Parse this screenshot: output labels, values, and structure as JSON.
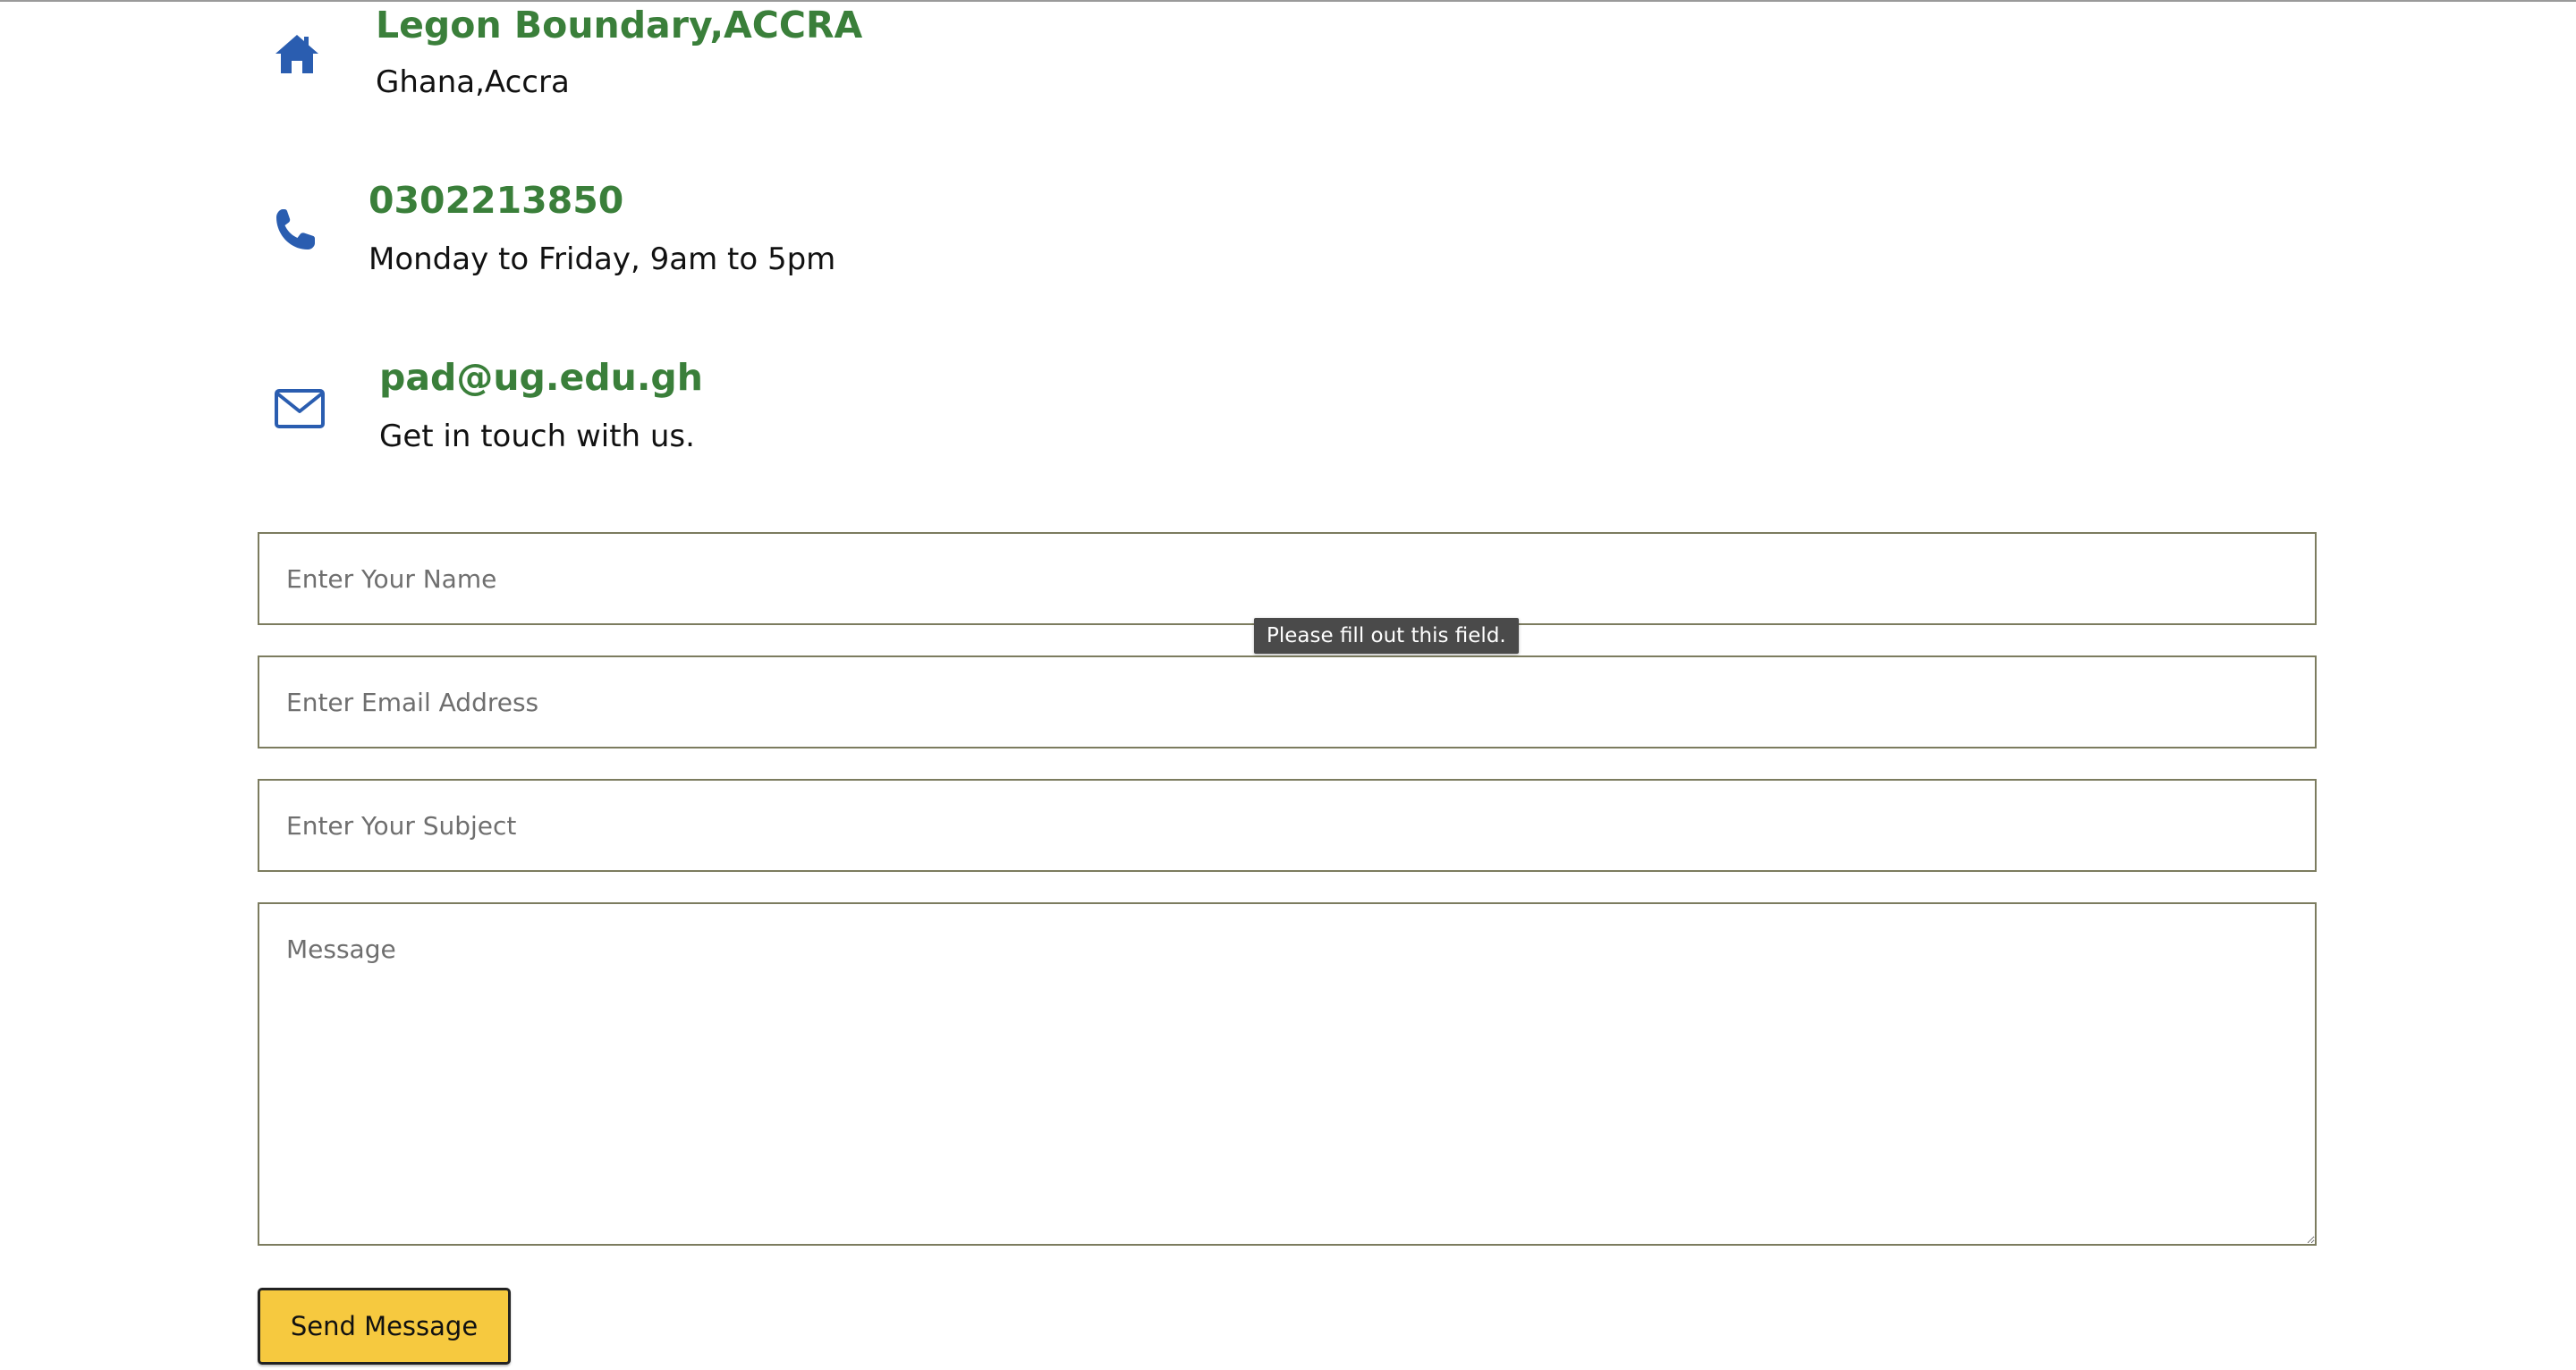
{
  "contact": {
    "address": {
      "title": "Legon Boundary,ACCRA",
      "subtitle": "Ghana,Accra",
      "icon": "home-icon"
    },
    "phone": {
      "title": "0302213850",
      "subtitle": "Monday to Friday, 9am to 5pm",
      "icon": "phone-icon"
    },
    "email": {
      "title": "pad@ug.edu.gh",
      "subtitle": "Get in touch with us.",
      "icon": "envelope-icon"
    }
  },
  "form": {
    "name_placeholder": "Enter Your Name",
    "name_value": "",
    "email_placeholder": "Enter Email Address",
    "email_value": "",
    "subject_placeholder": "Enter Your Subject",
    "subject_value": "",
    "message_placeholder": "Message",
    "message_value": "",
    "validation_tooltip": "Please fill out this field.",
    "submit_label": "Send Message"
  },
  "colors": {
    "accent_green": "#3a7f3a",
    "icon_blue": "#2a5db0",
    "button_yellow": "#f6c93f"
  }
}
